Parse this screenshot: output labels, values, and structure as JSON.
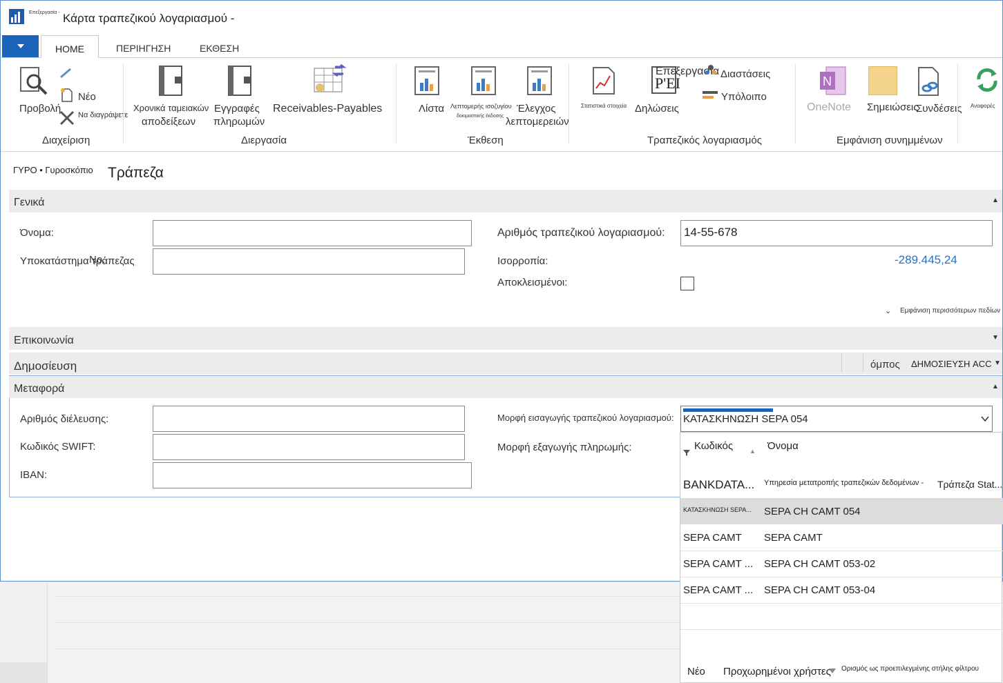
{
  "window": {
    "title": "Κάρτα τραπεζικού λογαριασμού -",
    "app_subtitle": "Επεξεργασία -"
  },
  "menu": {
    "file_icon": "caret-down-icon",
    "tabs": [
      "HOME",
      "ΠΕΡΙΗΓΗΣΗ",
      "ΕΚΘΕΣΗ"
    ]
  },
  "ribbon": {
    "view": "Προβολή",
    "new": "Νέο",
    "delete": "Να διαγράψετε",
    "receipt_journals_1": "Χρονικά ταμειακών",
    "receipt_journals_2": "αποδείξεων",
    "payment_journals_1": "Εγγραφές",
    "payment_journals_2": "πληρωμών",
    "receivables_payables": "Receivables-Payables",
    "list": "Λίστα",
    "detailed_trial_1": "Λεπτομερής ισοζυγίου",
    "detailed_trial_2": "δοκιμαστικής έκδοσης",
    "check_details_1": "Έλεγχος",
    "check_details_2": "λεπτομερειών",
    "statistics": "Στατιστικά στοιχεία",
    "edit": "Επεξεργασία",
    "rei": "Ρ'ΕΙ",
    "statements": "Δηλώσεις",
    "dimensions": "Διαστάσεις",
    "balance": "Υπόλοιπο",
    "onenote": "OneNote",
    "notes": "Σημειώσεις",
    "links": "Συνδέσεις",
    "refresh": "Αναφορές",
    "groups": {
      "manage": "Διαχείριση",
      "process": "Διεργασία",
      "report": "Έκθεση",
      "bank_account": "Τραπεζικός λογαριασμός",
      "attachments": "Εμφάνιση συνημμένων"
    }
  },
  "header": {
    "breadcrumb": "ΓΥΡΟ • Γυροσκόπιο",
    "page_title": "Τράπεζα"
  },
  "general": {
    "title": "Γενικά",
    "name_label": "Όνομα:",
    "name_value": "",
    "branch_label": "Υποκατάστημα τράπεζας",
    "branch_overlap": "Νο.",
    "branch_value": "",
    "account_label": "Αριθμός τραπεζικού λογαριασμού:",
    "account_value": "14-55-678",
    "balance_label": "Ισορροπία:",
    "balance_value": "-289.445,24",
    "blocked_label": "Αποκλεισμένοι:",
    "show_more": "Εμφάνιση περισσότερων πεδίων"
  },
  "communication": {
    "title": "Επικοινωνία"
  },
  "posting": {
    "title": "Δημοσίευση",
    "group": "όμπος",
    "posting_acc": "ΔΗΜΟΣΙΕΥΣΗ ACC"
  },
  "transfer": {
    "title": "Μεταφορά",
    "transit_label": "Αριθμός διέλευσης:",
    "swift_label": "Κωδικός SWIFT:",
    "iban_label": "IBAN:",
    "import_label": "Μορφή εισαγωγής τραπεζικού λογαριασμού:",
    "import_value": "ΚΑΤΑΣΚΗΝΩΣΗ SEPA 054",
    "export_label": "Μορφή εξαγωγής πληρωμής:"
  },
  "dropdown": {
    "col_code": "Κωδικός",
    "col_name": "Όνομα",
    "rows": [
      {
        "code": "BANKDATA...",
        "name": "Υπηρεσία μετατροπής τραπεζικών δεδομένων -",
        "extra": "Τράπεζα Stat..."
      },
      {
        "code": "ΚΑΤΑΣΚΗΝΩΣΗ SEPA...",
        "name": "SEPA CH CAMT 054",
        "extra": ""
      },
      {
        "code": "SEPA CAMT",
        "name": "SEPA CAMT",
        "extra": ""
      },
      {
        "code": "SEPA CAMT ...",
        "name": "SEPA CH CAMT 053-02",
        "extra": ""
      },
      {
        "code": "SEPA CAMT ...",
        "name": "SEPA CH CAMT 053-04",
        "extra": ""
      }
    ],
    "footer_new": "Νέο",
    "footer_advanced": "Προχωρημένοι χρήστες",
    "footer_default_filter": "Ορισμός ως προεπιλεγμένης στήλης φίλτρου"
  },
  "colors": {
    "accent": "#1a63b8",
    "balance": "#1f74c8",
    "section_bg": "#ececec",
    "selected_row": "#dcdcdc"
  }
}
